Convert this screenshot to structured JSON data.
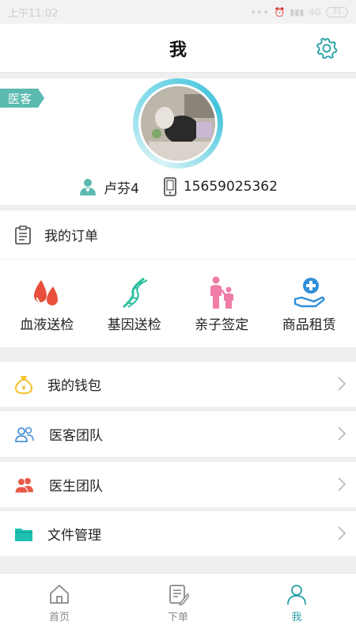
{
  "status": {
    "time": "上午11:02",
    "network": "4G",
    "battery": "31"
  },
  "header": {
    "title": "我"
  },
  "profile": {
    "role_tag": "医客",
    "name": "卢芬4",
    "phone": "15659025362"
  },
  "orders": {
    "title": "我的订单",
    "items": [
      {
        "label": "血液送检",
        "icon": "blood-drop-icon"
      },
      {
        "label": "基因送检",
        "icon": "dna-icon"
      },
      {
        "label": "亲子签定",
        "icon": "parent-child-icon"
      },
      {
        "label": "商品租赁",
        "icon": "hand-cross-icon"
      }
    ]
  },
  "menu": {
    "wallet": "我的钱包",
    "team": "医客团队",
    "doctor_team": "医生团队",
    "files": "文件管理"
  },
  "nav": {
    "home": "首页",
    "order": "下单",
    "me": "我"
  },
  "colors": {
    "accent": "#26a0a6",
    "tag": "#5bbab0",
    "blood": "#e8503b",
    "dna": "#2bbfa0",
    "family": "#f07ca8",
    "hand": "#2f8fd8",
    "wallet": "#f4c22b",
    "team": "#4a90d9",
    "doctor": "#e85b4a",
    "folder": "#1ec0b0"
  }
}
